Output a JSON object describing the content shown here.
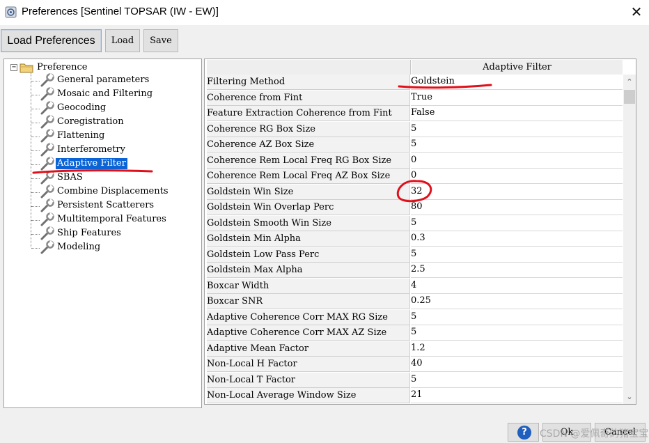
{
  "window": {
    "title": "Preferences [Sentinel TOPSAR (IW - EW)]",
    "close_glyph": "✕"
  },
  "toolbar": {
    "load_preferences_label": "Load Preferences",
    "load_label": "Load",
    "save_label": "Save"
  },
  "tree": {
    "root_label": "Preference",
    "toggle_glyph": "−",
    "items": [
      {
        "label": "General parameters"
      },
      {
        "label": "Mosaic and Filtering"
      },
      {
        "label": "Geocoding"
      },
      {
        "label": "Coregistration"
      },
      {
        "label": "Flattening"
      },
      {
        "label": "Interferometry"
      },
      {
        "label": "Adaptive Filter",
        "selected": true
      },
      {
        "label": "SBAS"
      },
      {
        "label": "Combine Displacements"
      },
      {
        "label": "Persistent Scatterers"
      },
      {
        "label": "Multitemporal Features"
      },
      {
        "label": "Ship Features"
      },
      {
        "label": "Modeling"
      }
    ]
  },
  "grid": {
    "header": "Adaptive Filter",
    "rows": [
      {
        "key": "Filtering Method",
        "value": "Goldstein"
      },
      {
        "key": "Coherence from Fint",
        "value": "True"
      },
      {
        "key": "Feature Extraction Coherence from Fint",
        "value": "False"
      },
      {
        "key": "Coherence RG Box Size",
        "value": "5"
      },
      {
        "key": "Coherence AZ Box Size",
        "value": "5"
      },
      {
        "key": "Coherence Rem Local Freq RG Box Size",
        "value": "0"
      },
      {
        "key": "Coherence Rem Local Freq AZ Box Size",
        "value": "0"
      },
      {
        "key": "Goldstein Win Size",
        "value": "32"
      },
      {
        "key": "Goldstein Win Overlap Perc",
        "value": "80"
      },
      {
        "key": "Goldstein Smooth Win Size",
        "value": "5"
      },
      {
        "key": "Goldstein Min Alpha",
        "value": "0.3"
      },
      {
        "key": "Goldstein Low Pass Perc",
        "value": "5"
      },
      {
        "key": "Goldstein Max Alpha",
        "value": "2.5"
      },
      {
        "key": "Boxcar Width",
        "value": "4"
      },
      {
        "key": "Boxcar SNR",
        "value": "0.25"
      },
      {
        "key": "Adaptive Coherence Corr MAX RG Size",
        "value": "5"
      },
      {
        "key": "Adaptive Coherence Corr MAX AZ Size",
        "value": "5"
      },
      {
        "key": "Adaptive Mean Factor",
        "value": "1.2"
      },
      {
        "key": "Non-Local H Factor",
        "value": "40"
      },
      {
        "key": "Non-Local T Factor",
        "value": "5"
      },
      {
        "key": "Non-Local Average Window Size",
        "value": "21"
      }
    ]
  },
  "scrollbar": {
    "up_glyph": "⌃",
    "down_glyph": "⌄"
  },
  "footer": {
    "help_glyph": "?",
    "ok_label": "Ok",
    "cancel_label": "Cancel",
    "watermark": "CSDN @爱佩奇的猪宝宝"
  },
  "colors": {
    "selection": "#0a64d6",
    "annotation_red": "#e0101a"
  },
  "icons": {
    "tree_item": "wrench-icon",
    "tree_root": "folder-icon",
    "help": "help-icon",
    "app": "app-icon"
  }
}
